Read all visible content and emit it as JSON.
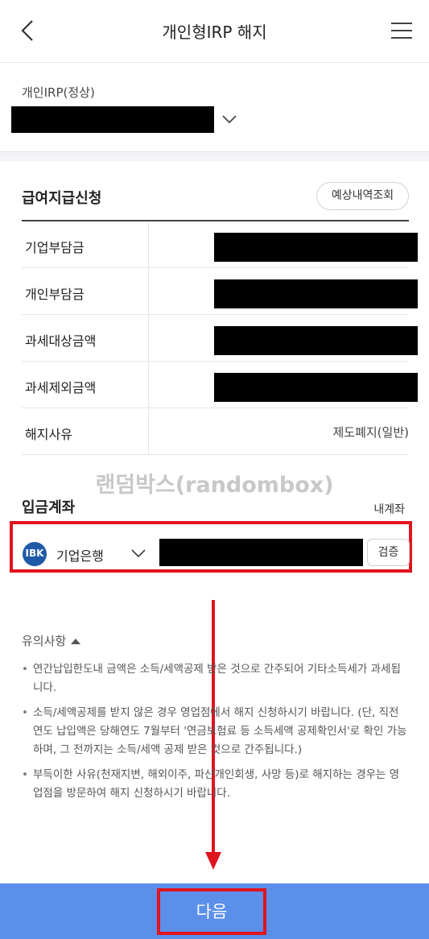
{
  "header": {
    "title": "개인형IRP 해지"
  },
  "account": {
    "type_label": "개인IRP(정상)"
  },
  "payment": {
    "title": "급여지급신청",
    "estimate_button": "예상내역조회",
    "rows": [
      {
        "label": "기업부담금",
        "value": ""
      },
      {
        "label": "개인부담금",
        "value": ""
      },
      {
        "label": "과세대상금액",
        "value": ""
      },
      {
        "label": "과세제외금액",
        "value": ""
      },
      {
        "label": "해지사유",
        "value": "제도폐지(일반)"
      }
    ]
  },
  "watermark": "랜덤박스(randombox)",
  "deposit": {
    "title": "입금계좌",
    "my_account_link": "내계좌",
    "bank_logo_text": "IBK",
    "bank_name": "기업은행",
    "verify_button": "검증"
  },
  "notice": {
    "title": "유의사항",
    "items": [
      "연간납입한도내 금액은 소득/세액공제 받은 것으로 간주되어 기타소득세가 과세됩니다.",
      "소득/세액공제를 받지 않은 경우 영업점에서 해지 신청하시기 바랍니다. (단, 직전연도 납입액은 당해연도 7월부터 '연금보험료 등 소득세액 공제확인서'로 확인 가능하며, 그 전까지는 소득/세액 공제 받은 것으로 간주됩니다.)",
      "부득이한 사유(천재지변, 해외이주, 파산개인회생, 사망 등)로 해지하는 경우는 영업점을 방문하여 해지 신청하시기 바랍니다."
    ]
  },
  "footer": {
    "next_button": "다음"
  },
  "colors": {
    "primary_button": "#5b8fea",
    "highlight_red": "#e0141e",
    "bank_blue": "#1f5aa6"
  },
  "icons": {
    "back": "chevron-left-icon",
    "menu": "hamburger-menu-icon",
    "dropdown": "chevron-down-icon",
    "collapse": "triangle-up-icon"
  }
}
